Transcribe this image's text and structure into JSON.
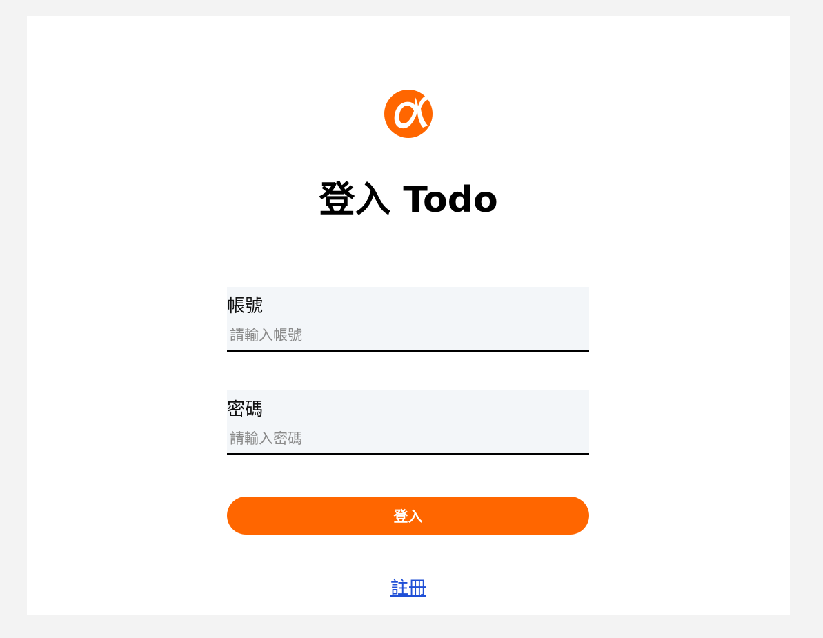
{
  "brand": {
    "logo_icon": "alpha-logo-icon",
    "accent_color": "#ff6600"
  },
  "page": {
    "title": "登入 Todo"
  },
  "form": {
    "account": {
      "label": "帳號",
      "placeholder": "請輸入帳號",
      "value": ""
    },
    "password": {
      "label": "密碼",
      "placeholder": "請輸入密碼",
      "value": ""
    },
    "submit_label": "登入"
  },
  "footer": {
    "register_label": "註冊"
  }
}
